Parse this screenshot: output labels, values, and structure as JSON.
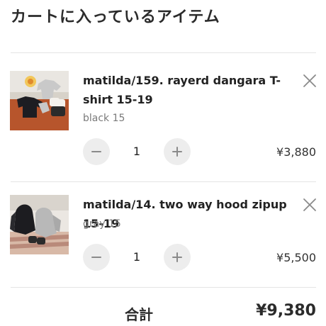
{
  "cart": {
    "title": "カートに入っているアイテム"
  },
  "items": [
    {
      "name": "matilda/159. rayerd dangara T-shirt 15-19",
      "variant": "black 15",
      "quantity": "1",
      "price": "¥3,880",
      "thumbnail_icon": "product-photo-tshirt"
    },
    {
      "name": "matilda/14. two way hood zipup 15-19",
      "variant": "gray 15",
      "quantity": "1",
      "price": "¥5,500",
      "thumbnail_icon": "product-photo-hoodie"
    }
  ],
  "summary": {
    "total_label": "合計",
    "total_value": "¥9,380"
  },
  "colors": {
    "qty_button_bg": "#ededed",
    "icon_gray": "#8a8a8a",
    "text_dark": "#222222",
    "text_muted": "#7a7a7a",
    "divider": "#e4e4e4"
  }
}
